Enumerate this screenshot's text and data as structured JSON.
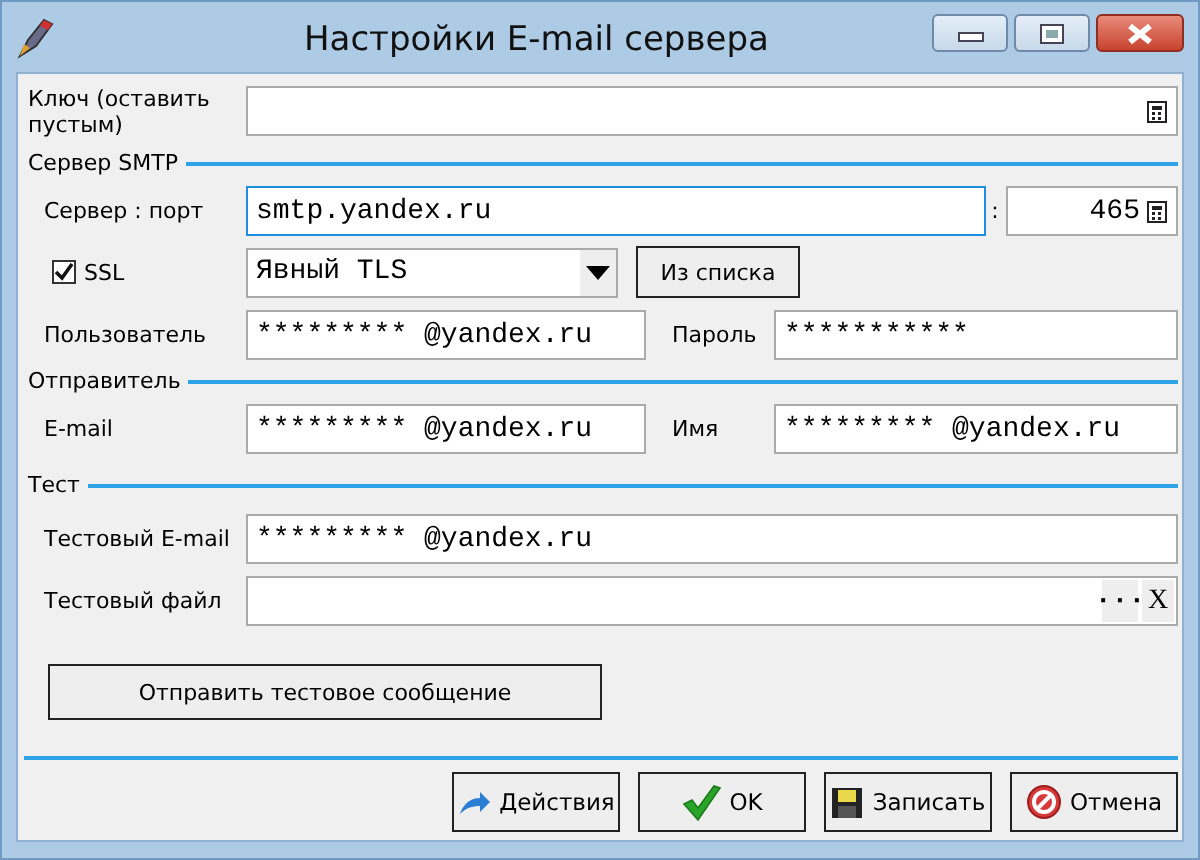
{
  "window": {
    "title": "Настройки E-mail сервера"
  },
  "key": {
    "label": "Ключ (оставить пустым)"
  },
  "smtp": {
    "title": "Сервер SMTP",
    "server_label": "Сервер : порт",
    "server": "smtp.yandex.ru",
    "server_focused": true,
    "port_separator": ":",
    "port": "465",
    "ssl": {
      "label": "SSL",
      "checked": true
    },
    "security": "Явный TLS",
    "from_list_button": "Из списка",
    "user_label": "Пользователь",
    "user": "********* @yandex.ru",
    "password_label": "Пароль",
    "password": "***********"
  },
  "sender": {
    "title": "Отправитель",
    "email_label": "E-mail",
    "email": "********* @yandex.ru",
    "name_label": "Имя",
    "name": "********* @yandex.ru"
  },
  "test": {
    "title": "Тест",
    "email_label": "Тестовый E-mail",
    "email": "********* @yandex.ru",
    "file_label": "Тестовый файл",
    "browse_button": "···",
    "clear_button": "X",
    "send_button": "Отправить тестовое сообщение"
  },
  "buttons": [
    {
      "label": "Действия",
      "kind": "actions"
    },
    {
      "label": "OK",
      "kind": "ok"
    },
    {
      "label": "Записать",
      "kind": "save"
    },
    {
      "label": "Отмена",
      "kind": "cancel"
    }
  ]
}
